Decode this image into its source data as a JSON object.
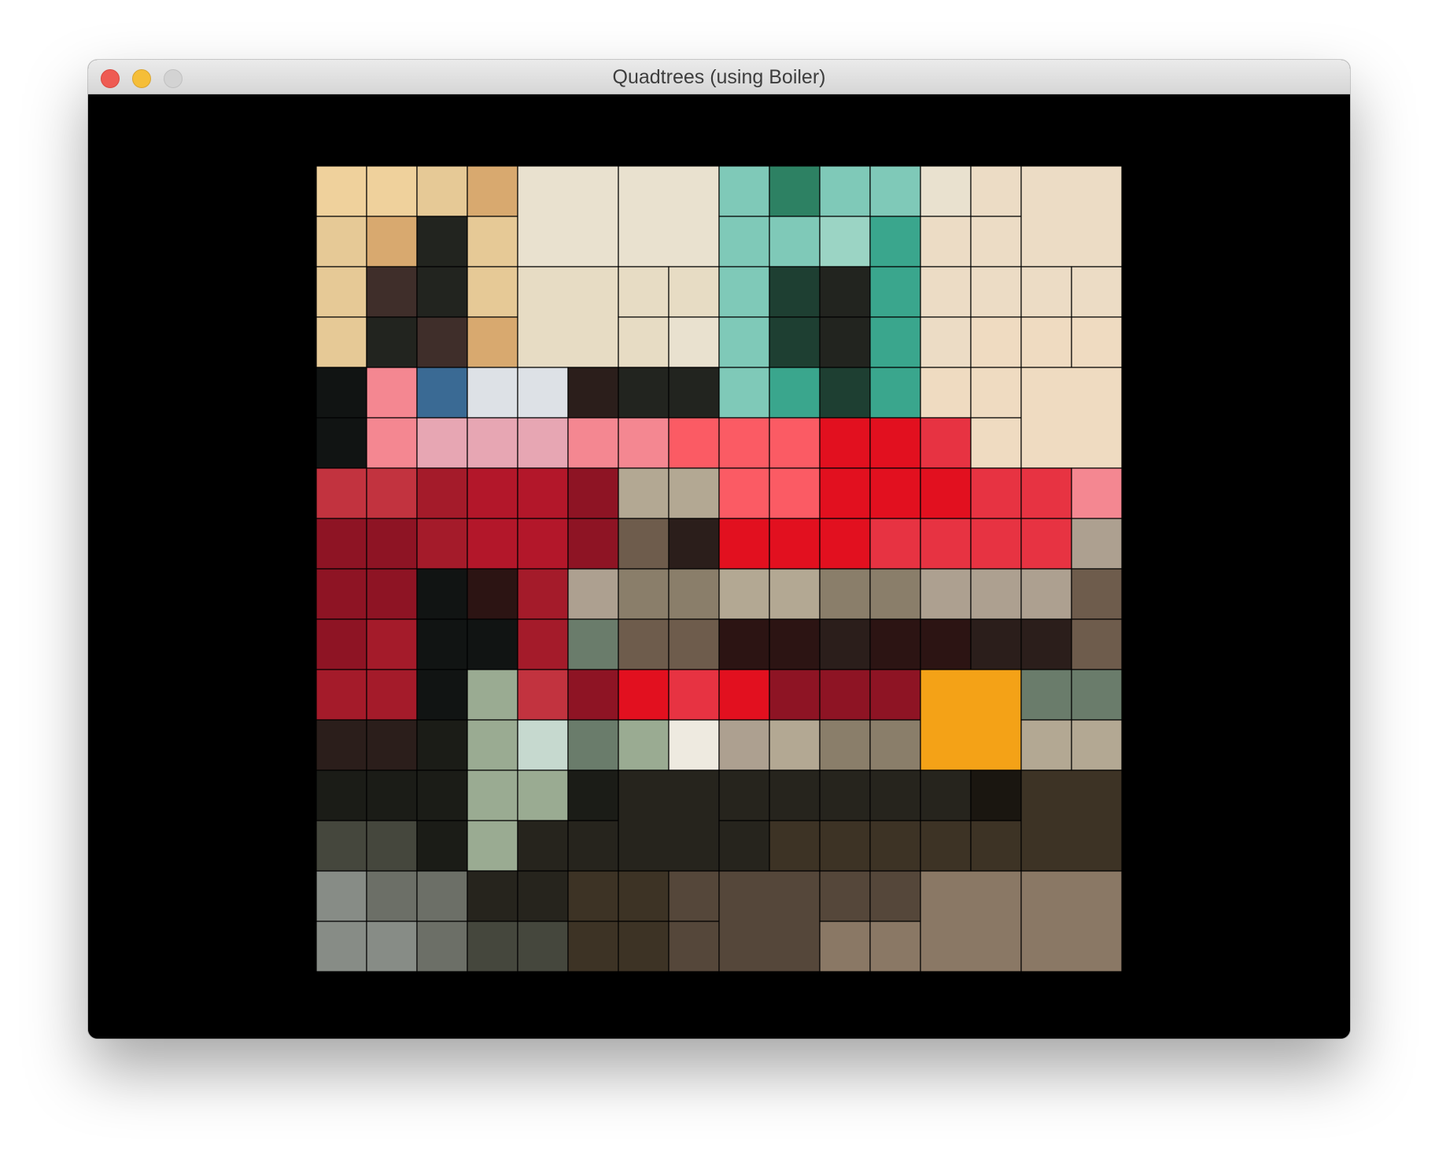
{
  "window": {
    "title": "Quadtrees (using Boiler)",
    "buttons": [
      {
        "name": "close",
        "color": "#ee5b53"
      },
      {
        "name": "minimize",
        "color": "#f5be38"
      },
      {
        "name": "zoom",
        "color": "#d3d3d3"
      }
    ],
    "background_color": "#000000"
  },
  "quadtree": {
    "cell_outline_color": "#000000",
    "palette": [
      "#efd19c",
      "#e6c996",
      "#d8a96f",
      "#e9e1cf",
      "#e7dcc4",
      "#efdbc1",
      "#ecdcc5",
      "#2d8163",
      "#19795c",
      "#7fc9b8",
      "#9bd4c4",
      "#3aa68d",
      "#1e3f32",
      "#22241f",
      "#3f2e2a",
      "#c2333f",
      "#a41b2a",
      "#8e1424",
      "#b3172a",
      "#e73342",
      "#e2101f",
      "#fb5b64",
      "#f48791",
      "#e7a6b3",
      "#dde1e6",
      "#3a6a94",
      "#111413",
      "#2b1e1b",
      "#6e5c4c",
      "#8a7e6a",
      "#b3a893",
      "#ada090",
      "#f4a217",
      "#1b1c17",
      "#26241d",
      "#3d3325",
      "#55473a",
      "#8a7865",
      "#878c86",
      "#6c6f67",
      "#45473d",
      "#1a1610",
      "#6a7c6b",
      "#9aab92",
      "#c6d9cf",
      "#2c1413",
      "#eeeae0",
      "#c2c4bd"
    ]
  }
}
